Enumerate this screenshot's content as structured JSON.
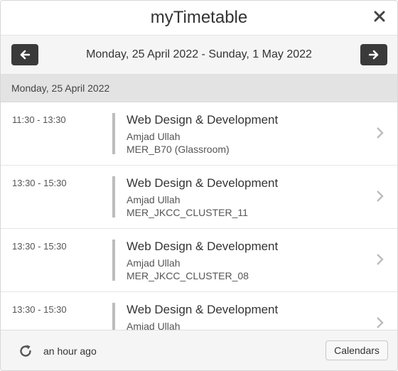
{
  "app": {
    "title": "myTimetable",
    "close_icon": "close-icon"
  },
  "week": {
    "range": "Monday, 25 April 2022 - Sunday, 1 May 2022",
    "prev_icon": "arrow-left-icon",
    "next_icon": "arrow-right-icon"
  },
  "day": {
    "label": "Monday, 25 April 2022"
  },
  "events": [
    {
      "time": "11:30 - 13:30",
      "subject": "Web Design & Development",
      "staff": "Amjad Ullah",
      "room": "MER_B70 (Glassroom)"
    },
    {
      "time": "13:30 - 15:30",
      "subject": "Web Design & Development",
      "staff": "Amjad Ullah",
      "room": "MER_JKCC_CLUSTER_11"
    },
    {
      "time": "13:30 - 15:30",
      "subject": "Web Design & Development",
      "staff": "Amjad Ullah",
      "room": "MER_JKCC_CLUSTER_08"
    },
    {
      "time": "13:30 - 15:30",
      "subject": "Web Design & Development",
      "staff": "Amjad Ullah",
      "room": ""
    }
  ],
  "footer": {
    "refresh_icon": "refresh-icon",
    "last_updated": "an hour ago",
    "calendars_label": "Calendars"
  },
  "colors": {
    "nav_button": "#3a3a3a",
    "event_bar": "#bdbdbd",
    "day_header_bg": "#e3e3e3"
  }
}
